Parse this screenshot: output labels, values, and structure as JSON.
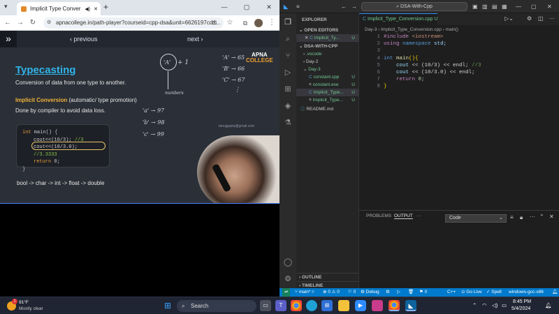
{
  "browser": {
    "tab_title": "Implicit Type Conversion",
    "tab_audio_icon": "speaker-icon",
    "tab_close": "✕",
    "new_tab": "+",
    "url": "apnacollege.in/path-player?courseid=cpp-dsa&unit=6626197cdd...",
    "window_min": "—",
    "window_max": "▢",
    "window_close": "✕"
  },
  "player": {
    "prev_label": "‹ previous",
    "next_label": "next ›",
    "brand_top": "APNA",
    "brand_bottom": "COLLEGE",
    "watermark": "tanujgupta@gmail.com"
  },
  "slide": {
    "title": "Typecasting",
    "definition": "Conversion of data from one type to another.",
    "implicit_title": "Implicit Conversion",
    "implicit_sub": " (automatic/ type promotion)",
    "done_by": "Done by compiler to avoid data loss.",
    "code": {
      "l1_kw": "int",
      "l1_rest": " main() {",
      "l2": "cout<<(10/3); ",
      "l2_cm": "//3",
      "l3": "cout<<(10/3.0); ",
      "l3_cm": "//3.3333",
      "l4_kw": "return",
      "l4_rest": " 0;",
      "l5": "}"
    },
    "promotion_chain": "bool -> char -> int -> float -> double",
    "handwriting": {
      "circle_a": "'A'",
      "plus_one": "+ 1",
      "numbers_label": "numbers",
      "map1": "'A'  →  65",
      "map2": "'B'  →  66",
      "map3": "'C'  →  67",
      "map4": "'a'  →  97",
      "map5": "'b'  →  98",
      "map6": "'c'  →  99",
      "dots": "⋮"
    }
  },
  "vscode": {
    "search_text": "DSA-With-Cpp",
    "explorer_label": "EXPLORER",
    "open_editors_label": "OPEN EDITORS",
    "open_editor_file": "Implicit_Ty...",
    "project_label": "DSA-WITH-CPP",
    "tree": [
      {
        "name": ".vscode"
      },
      {
        "name": "Day-2"
      },
      {
        "name": "Day-3"
      },
      {
        "name": "constant.cpp",
        "badge": "U"
      },
      {
        "name": "constant.exe",
        "badge": "U"
      },
      {
        "name": "Implicit_Type...",
        "badge": "U"
      },
      {
        "name": "Implicit_Type...",
        "badge": "U"
      },
      {
        "name": "README.md"
      }
    ],
    "outline_label": "OUTLINE",
    "timeline_label": "TIMELINE",
    "editor_tab": "Implicit_Type_Conversion.cpp",
    "editor_tab_badge": "U",
    "breadcrumb": "Day-3 › Implicit_Type_Conversion.cpp › main()",
    "line_numbers": [
      "1",
      "2",
      "3",
      "4",
      "5",
      "6",
      "7",
      "8"
    ],
    "code_lines": {
      "l1_a": "#include ",
      "l1_b": "<iostream>",
      "l2_a": "using ",
      "l2_b": "namespace ",
      "l2_c": "std;",
      "l4_a": "int ",
      "l4_b": "main",
      "l4_c": "(){",
      "l5_a": "    cout ",
      "l5_b": "<< (10/3) << endl; ",
      "l5_c": "//3",
      "l6_a": "    cout ",
      "l6_b": "<< (10/3.0) << endl;",
      "l7_a": "    return ",
      "l7_b": "0;",
      "l8": "}"
    },
    "panel": {
      "problems": "PROBLEMS",
      "output": "OUTPUT",
      "more": "···",
      "output_select": "Code"
    },
    "status": {
      "branch": "main*",
      "errors": "⊗ 0 ⚠ 0",
      "warnings": "⚠ 0",
      "debug": "Debug",
      "lang": "C++",
      "golive": "Go Live",
      "spell": "Spell",
      "compiler": "windows-gcc-x86",
      "count0": "0"
    }
  },
  "taskbar": {
    "weather_temp": "91°F",
    "weather_desc": "Mostly clear",
    "weather_badge": "1",
    "search_label": "Search",
    "time": "8:45 PM",
    "date": "5/4/2024"
  },
  "colors": {
    "vscode_accent": "#007acc",
    "slide_title": "#2fb4e8",
    "taskbar_bg": "#1f2533"
  }
}
